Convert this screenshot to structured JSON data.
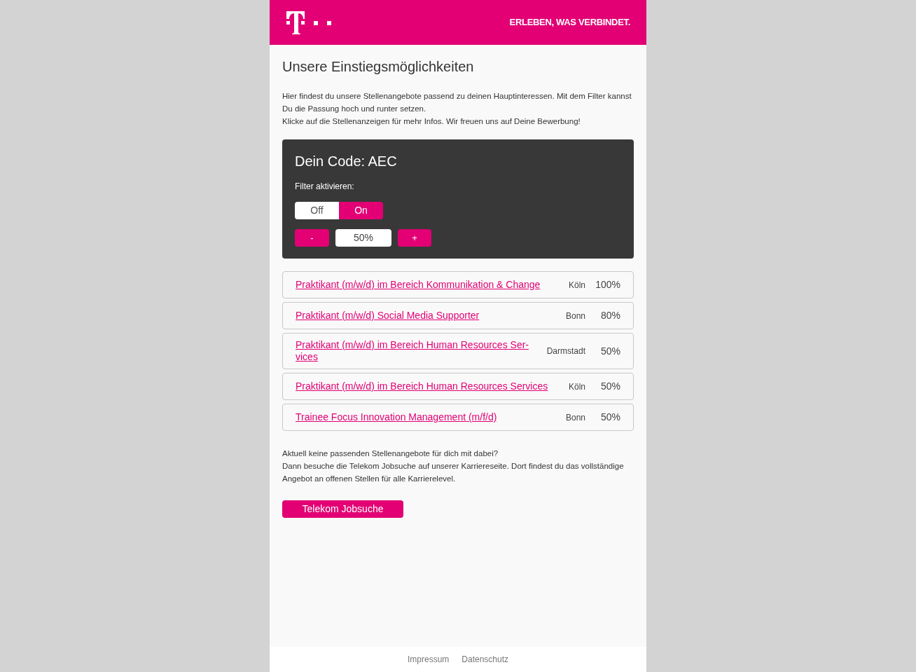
{
  "header": {
    "slogan": "ERLEBEN, WAS VERBINDET."
  },
  "title": "Unsere Einstiegsmöglichkeiten",
  "intro": [
    "Hier findest du unsere Stellenangebote passend zu deinen Hauptinteressen. Mit dem Filter kannst Du die Passung hoch und runter setzen.",
    "Klicke auf die Stellenanzeigen für mehr Infos. Wir freuen uns auf Deine Bewerbung!"
  ],
  "filter_panel": {
    "code_title": "Dein Code: AEC",
    "label": "Filter aktivieren:",
    "toggle": [
      {
        "label": "Off",
        "selected": false
      },
      {
        "label": "On",
        "selected": true
      }
    ],
    "decrease": "-",
    "value": "50%",
    "increase": "+"
  },
  "jobs": [
    {
      "title": "Praktikant (m/w/d) im Bereich Kommunikation & Change",
      "location": "Köln",
      "match": "100%"
    },
    {
      "title": "Praktikant (m/w/d) Social Media Supporter",
      "location": "Bonn",
      "match": "80%"
    },
    {
      "title": "Praktikant (m/w/d) im Bereich Human Resources Ser-vices",
      "location": "Darmstadt",
      "match": "50%"
    },
    {
      "title": "Praktikant (m/w/d) im Bereich Human Resources Services",
      "location": "Köln",
      "match": "50%"
    },
    {
      "title": "Trainee Focus Innovation Management (m/f/d)",
      "location": "Bonn",
      "match": "50%"
    }
  ],
  "outro": [
    "Aktuell keine passenden Stellenangebote für dich mit dabei?",
    "Dann besuche die Telekom Jobsuche auf unserer Karriereseite. Dort findest du das vollständige Angebot an offenen Stellen für alle Karrierelevel."
  ],
  "cta_button": "Telekom Jobsuche",
  "footer_links": [
    "Impressum",
    "Datenschutz"
  ]
}
